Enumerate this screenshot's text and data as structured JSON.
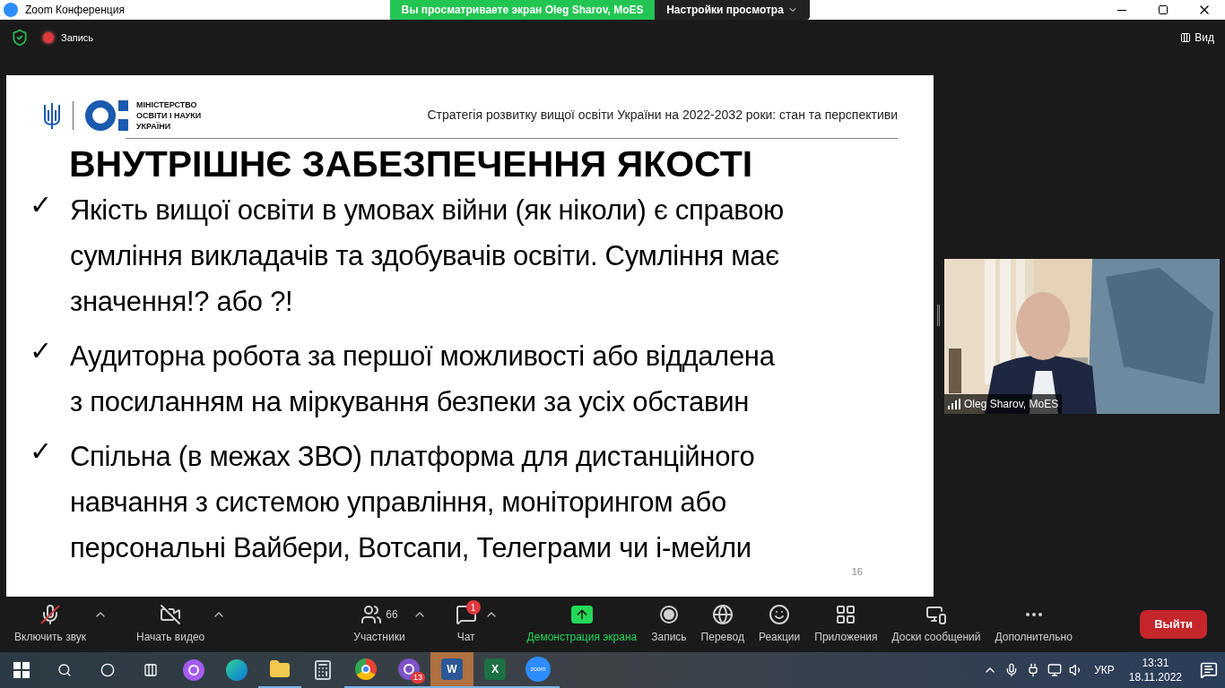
{
  "window": {
    "title": "Zoom Конференция"
  },
  "banner": {
    "text": "Вы просматриваете экран Oleg Sharov, MoES",
    "settings": "Настройки просмотра"
  },
  "top_bar": {
    "record": "Запись",
    "view": "Вид"
  },
  "slide": {
    "logo_lines": [
      "МІНІСТЕРСТВО",
      "ОСВІТИ І НАУКИ",
      "УКРАЇНИ"
    ],
    "header": "Стратегія розвитку вищої освіти України на 2022-2032 роки: стан та перспективи",
    "title": "ВНУТРІШНЄ ЗАБЕЗПЕЧЕННЯ ЯКОСТІ",
    "bullets": [
      {
        "mark": "✓",
        "lines": [
          "Якість вищої освіти в умовах війни (як ніколи) є справою",
          "сумління викладачів та здобувачів освіти. Сумління має",
          "значення!? або ?!"
        ]
      },
      {
        "mark": "✓",
        "lines": [
          "Аудиторна робота за першої можливості або віддалена",
          "з посиланням на міркування безпеки за усіх обставин"
        ]
      },
      {
        "mark": "✓",
        "lines": [
          "Спільна (в межах ЗВО) платформа для дистанційного",
          "навчання з системою управління, моніторингом або",
          "персональні Вайбери, Вотсапи, Телеграми чи і-мейли"
        ]
      }
    ],
    "page_number": "16"
  },
  "video": {
    "name": "Oleg Sharov, MoES"
  },
  "toolbar": [
    {
      "kind": "mic",
      "label": "Включить звук",
      "off": true,
      "menu": true
    },
    {
      "kind": "camera",
      "label": "Начать видео",
      "off": true,
      "menu": true
    },
    {
      "kind": "participants",
      "label": "Участники",
      "count": "66",
      "menu": true
    },
    {
      "kind": "chat",
      "label": "Чат",
      "badge": "1",
      "menu": true
    },
    {
      "kind": "share",
      "label": "Демонстрация экрана",
      "active": true
    },
    {
      "kind": "record",
      "label": "Запись"
    },
    {
      "kind": "globe",
      "label": "Перевод"
    },
    {
      "kind": "reactions",
      "label": "Реакции"
    },
    {
      "kind": "apps",
      "label": "Приложения"
    },
    {
      "kind": "board",
      "label": "Доски сообщений"
    },
    {
      "kind": "more",
      "label": "Дополнительно"
    }
  ],
  "leave": "Выйти",
  "taskbar": {
    "apps": [
      {
        "kind": "alice",
        "running": false,
        "active": false
      },
      {
        "kind": "edge",
        "running": false,
        "active": false
      },
      {
        "kind": "folder",
        "running": true,
        "active": false
      },
      {
        "kind": "calculator",
        "running": false,
        "active": false
      },
      {
        "kind": "chrome",
        "running": true,
        "active": false
      },
      {
        "kind": "viber",
        "running": true,
        "active": false,
        "badge": "13"
      },
      {
        "kind": "word",
        "running": true,
        "active": true,
        "letter": "W"
      },
      {
        "kind": "excel",
        "running": true,
        "active": false,
        "letter": "X"
      },
      {
        "kind": "zoom",
        "running": true,
        "active": false,
        "letter": "zoom"
      }
    ],
    "language": "УКР",
    "time": "13:31",
    "date": "18.11.2022"
  }
}
